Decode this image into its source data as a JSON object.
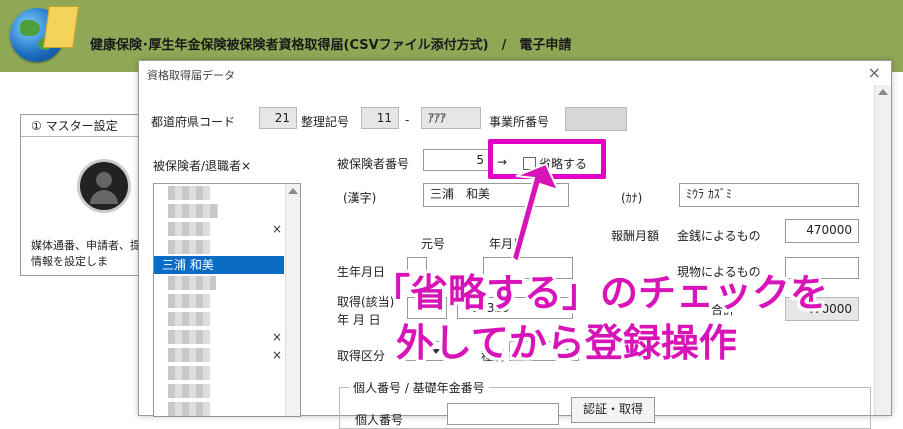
{
  "app": {
    "title": "健康保険･厚生年金保険被保険者資格取得届(CSVファイル添付方式)　/　電子申請"
  },
  "background_panel": {
    "tab_label": "① マスター設定",
    "line1": "媒体通番、申請者、提",
    "line2": "情報を設定しま"
  },
  "dialog": {
    "title": "資格取得届データ",
    "close": "×"
  },
  "form": {
    "pref_code_label": "都道府県コード",
    "pref_code_value": "21",
    "seiri_label": "整理記号",
    "seiri_value1": "11",
    "seiri_dash": "-",
    "seiri_value2": "ｱｱｱ",
    "office_no_label": "事業所番号",
    "insured_list_label": "被保険者/退職者×",
    "insured_no_label": "被保険者番号",
    "insured_no_value": "5",
    "arrow": "→",
    "omit_label": "省略する",
    "kanji_label": "(漢字)",
    "kanji_value": "三浦　和美",
    "kana_label": "(ｶﾅ)",
    "kana_value": "ﾐｳﾗ ｶｽﾞﾐ",
    "gengo_label": "元号",
    "nengappi_label": "年月日",
    "monthly_pay_label": "報酬月額",
    "money_label": "金銭によるもの",
    "money_value": "470000",
    "birth_label": "生年月日",
    "goods_label": "現物によるもの",
    "acquire_label": "取得(該当)",
    "acquire_label2": "年 月 日",
    "acquire_era": "5",
    "acquire_date": "590329",
    "total_label": "合計",
    "total_value": "470000",
    "acquire_kubun_label": "取得区分",
    "kind_label": "種別",
    "mynumber_group_label": "個人番号 / 基礎年金番号",
    "mynumber_label": "個人番号",
    "auth_button": "認証・取得"
  },
  "insured_list": {
    "selected": "三浦 和美",
    "x_marks": [
      "×",
      "×",
      "×"
    ]
  },
  "annotation": {
    "line1": "「省略する」のチェックを",
    "line2": "外してから登録操作"
  },
  "colors": {
    "header_bg": "#8fa856",
    "highlight": "#e100c4",
    "selection": "#0a6cc5"
  }
}
